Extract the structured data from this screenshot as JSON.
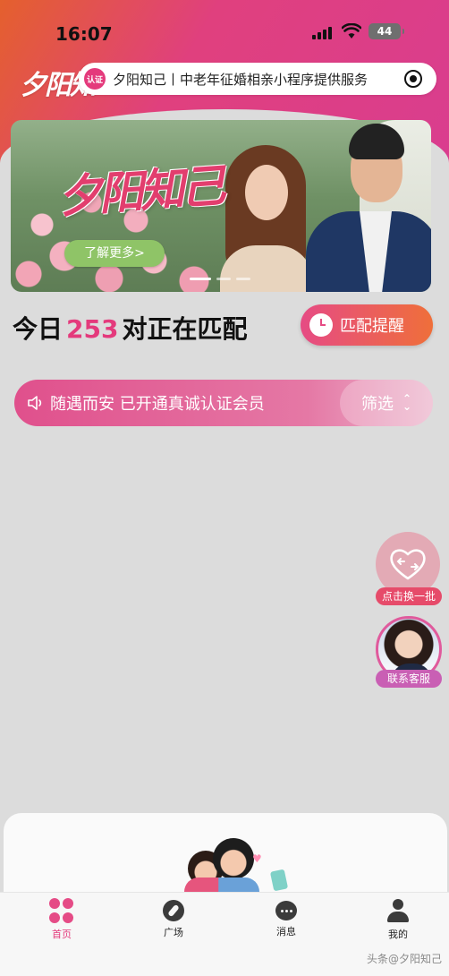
{
  "status_bar": {
    "time": "16:07",
    "battery": "44"
  },
  "header": {
    "logo": "夕阳知",
    "badge": "认证",
    "title": "夕阳知己丨中老年征婚相亲小程序提供服务"
  },
  "banner": {
    "title": "夕阳知己",
    "button": "了解更多>"
  },
  "match": {
    "prefix": "今日",
    "count": "253",
    "suffix": "对正在匹配",
    "reminder_label": "匹配提醒"
  },
  "notice": {
    "text": "随遇而安 已开通真诚认证会员",
    "filter_label": "筛选"
  },
  "floating": {
    "refresh_label": "点击换一批",
    "service_label": "联系客服"
  },
  "tabs": [
    {
      "label": "首页",
      "icon": "home-icon",
      "active": true
    },
    {
      "label": "广场",
      "icon": "compass-icon",
      "active": false
    },
    {
      "label": "消息",
      "icon": "message-icon",
      "active": false
    },
    {
      "label": "我的",
      "icon": "user-icon",
      "active": false
    }
  ],
  "watermark": "头条@夕阳知己",
  "colors": {
    "brand": "#e43a7c",
    "accent_orange": "#ef6f3a",
    "banner_button": "#8fc467"
  }
}
